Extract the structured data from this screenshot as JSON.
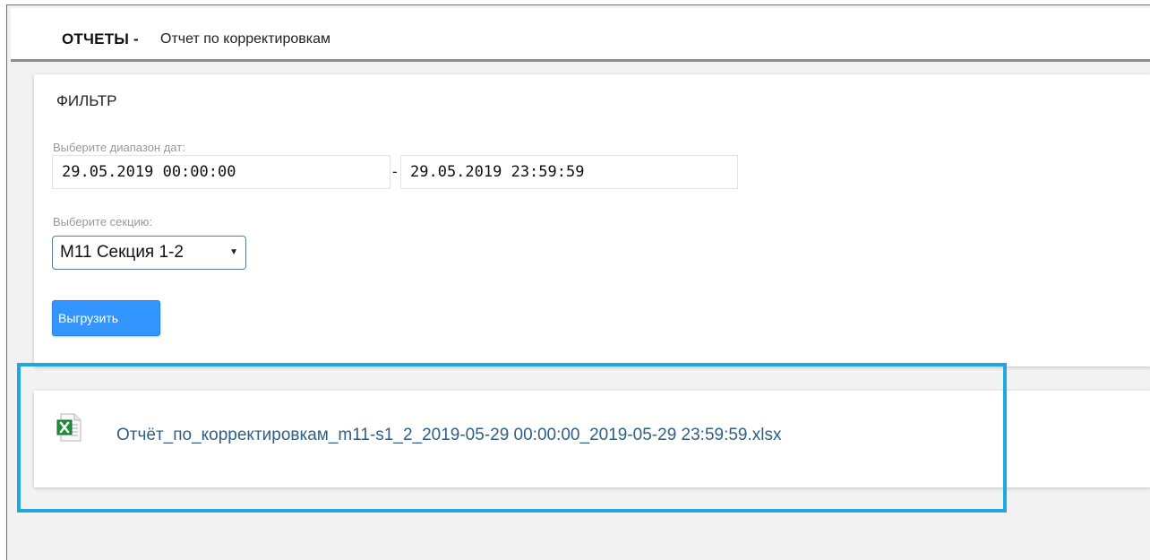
{
  "header": {
    "title": "ОТЧЕТЫ -",
    "subtitle": "Отчет по корректировкам"
  },
  "filter": {
    "title": "ФИЛЬТР",
    "date_range_label": "Выберите диапазон дат:",
    "date_from": "29.05.2019 00:00:00",
    "date_separator": "-",
    "date_to": "29.05.2019 23:59:59",
    "section_label": "Выберите секцию:",
    "section_selected": "М11 Секция 1-2",
    "export_button": "Выгрузить"
  },
  "result": {
    "file_icon": "excel-file-icon",
    "file_name": "Отчёт_по_корректировкам_m11-s1_2_2019-05-29 00:00:00_2019-05-29 23:59:59.xlsx"
  },
  "colors": {
    "accent_button": "#3395ff",
    "link": "#2f5f87",
    "highlight": "#1ea7e1"
  }
}
